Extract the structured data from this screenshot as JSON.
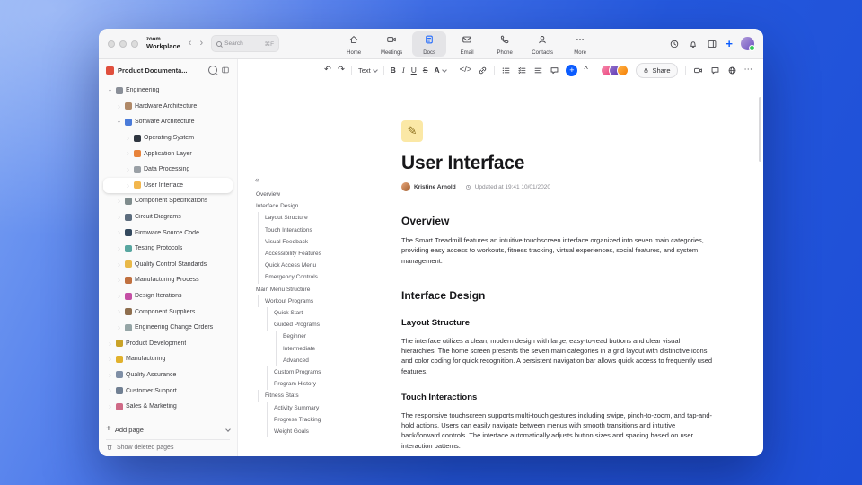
{
  "accent": "#0b5cff",
  "topbar": {
    "brand": {
      "name": "zoom",
      "product": "Workplace"
    },
    "nav": {
      "back": "‹",
      "forward": "›"
    },
    "search": {
      "label": "Search",
      "shortcut": "⌘F"
    },
    "tabs": [
      {
        "id": "home",
        "label": "Home",
        "active": false
      },
      {
        "id": "meetings",
        "label": "Meetings",
        "active": false
      },
      {
        "id": "docs",
        "label": "Docs",
        "active": true
      },
      {
        "id": "email",
        "label": "Email",
        "active": false
      },
      {
        "id": "phone",
        "label": "Phone",
        "active": false
      },
      {
        "id": "contacts",
        "label": "Contacts",
        "active": false
      },
      {
        "id": "more",
        "label": "More",
        "active": false
      }
    ]
  },
  "sidebar": {
    "workspace_label": "Product Documenta...",
    "tree": [
      {
        "label": "Engineering",
        "level": 0,
        "expanded": true,
        "selected": false,
        "color": "#8a8f98"
      },
      {
        "label": "Hardware Architecture",
        "level": 1,
        "expanded": false,
        "selected": false,
        "color": "#b08968"
      },
      {
        "label": "Software Architecture",
        "level": 1,
        "expanded": true,
        "selected": false,
        "color": "#4a7bd9"
      },
      {
        "label": "Operating System",
        "level": 2,
        "expanded": false,
        "selected": false,
        "color": "#2f3640"
      },
      {
        "label": "Application Layer",
        "level": 2,
        "expanded": false,
        "selected": false,
        "color": "#e8833a"
      },
      {
        "label": "Data Processing",
        "level": 2,
        "expanded": false,
        "selected": false,
        "color": "#9aa0a6"
      },
      {
        "label": "User Interface",
        "level": 2,
        "expanded": false,
        "selected": true,
        "color": "#f2b64c"
      },
      {
        "label": "Component Specifications",
        "level": 1,
        "expanded": false,
        "selected": false,
        "color": "#7f8c8d"
      },
      {
        "label": "Circuit Diagrams",
        "level": 1,
        "expanded": false,
        "selected": false,
        "color": "#5d6d7e"
      },
      {
        "label": "Firmware Source Code",
        "level": 1,
        "expanded": false,
        "selected": false,
        "color": "#34495e"
      },
      {
        "label": "Testing Protocols",
        "level": 1,
        "expanded": false,
        "selected": false,
        "color": "#58a6a0"
      },
      {
        "label": "Quality Control Standards",
        "level": 1,
        "expanded": false,
        "selected": false,
        "color": "#e9b949"
      },
      {
        "label": "Manufacturing Process",
        "level": 1,
        "expanded": false,
        "selected": false,
        "color": "#c0703f"
      },
      {
        "label": "Design Iterations",
        "level": 1,
        "expanded": false,
        "selected": false,
        "color": "#c44fa5"
      },
      {
        "label": "Component Suppliers",
        "level": 1,
        "expanded": false,
        "selected": false,
        "color": "#8e6e4e"
      },
      {
        "label": "Engineering Change Orders",
        "level": 1,
        "expanded": false,
        "selected": false,
        "color": "#95a5a6"
      },
      {
        "label": "Product Development",
        "level": 0,
        "expanded": false,
        "selected": false,
        "color": "#c9a227"
      },
      {
        "label": "Manufacturing",
        "level": 0,
        "expanded": false,
        "selected": false,
        "color": "#e1b12c"
      },
      {
        "label": "Quality Assurance",
        "level": 0,
        "expanded": false,
        "selected": false,
        "color": "#7f8fa6"
      },
      {
        "label": "Customer Support",
        "level": 0,
        "expanded": false,
        "selected": false,
        "color": "#718093"
      },
      {
        "label": "Sales & Marketing",
        "level": 0,
        "expanded": false,
        "selected": false,
        "color": "#cf6a87"
      }
    ],
    "add_page_plus": "+",
    "add_page_label": "Add page",
    "show_deleted_label": "Show deleted pages"
  },
  "outline": {
    "collapse": "«",
    "items": [
      {
        "label": "Overview",
        "level": 0
      },
      {
        "label": "Interface Design",
        "level": 0
      },
      {
        "label": "Layout Structure",
        "level": 1
      },
      {
        "label": "Touch Interactions",
        "level": 1
      },
      {
        "label": "Visual Feedback",
        "level": 1
      },
      {
        "label": "Accessibility Features",
        "level": 1
      },
      {
        "label": "Quick Access Menu",
        "level": 1
      },
      {
        "label": "Emergency Controls",
        "level": 1
      },
      {
        "label": "Main Menu Structure",
        "level": 0
      },
      {
        "label": "Workout Programs",
        "level": 1
      },
      {
        "label": "Quick Start",
        "level": 2
      },
      {
        "label": "Guided Programs",
        "level": 2
      },
      {
        "label": "Beginner",
        "level": 3
      },
      {
        "label": "Intermediate",
        "level": 3
      },
      {
        "label": "Advanced",
        "level": 3
      },
      {
        "label": "Custom Programs",
        "level": 2
      },
      {
        "label": "Program History",
        "level": 2
      },
      {
        "label": "Fitness Stats",
        "level": 1
      },
      {
        "label": "Activity Summary",
        "level": 2
      },
      {
        "label": "Progress Tracking",
        "level": 2
      },
      {
        "label": "Weight Goals",
        "level": 2
      }
    ]
  },
  "doctoolbar": {
    "undo": "↶",
    "redo": "↷",
    "text_style": "Text",
    "bold": "B",
    "italic": "I",
    "underline": "U",
    "strikethrough": "S",
    "text_color": "A",
    "code": "</>",
    "insert": "+",
    "collapse": "^",
    "share_label": "Share",
    "more": "⋯"
  },
  "doc": {
    "icon_glyph": "✎",
    "title": "User Interface",
    "author": "Kristine Arnold",
    "updated": "Updated at 19:41 10/01/2020",
    "blocks": [
      {
        "type": "h2",
        "text": "Overview"
      },
      {
        "type": "p",
        "text": "The Smart Treadmill features an intuitive touchscreen interface organized into seven main categories, providing easy access to workouts, fitness tracking, virtual experiences, social features, and system management."
      },
      {
        "type": "h2",
        "text": "Interface Design"
      },
      {
        "type": "h3",
        "text": "Layout Structure"
      },
      {
        "type": "p",
        "text": "The interface utilizes a clean, modern design with large, easy-to-read buttons and clear visual hierarchies. The home screen presents the seven main categories in a grid layout with distinctive icons and color coding for quick recognition. A persistent navigation bar allows quick access to frequently used features."
      },
      {
        "type": "h3",
        "text": "Touch Interactions"
      },
      {
        "type": "p",
        "text": "The responsive touchscreen supports multi-touch gestures including swipe, pinch-to-zoom, and tap-and-hold actions. Users can easily navigate between menus with smooth transitions and intuitive back/forward controls. The interface automatically adjusts button sizes and spacing based on user interaction patterns."
      }
    ]
  }
}
